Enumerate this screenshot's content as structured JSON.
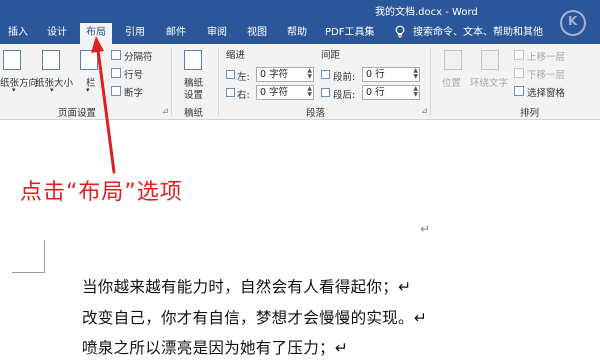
{
  "window": {
    "title": "我的文档.docx  -  Word"
  },
  "tabs": [
    "插入",
    "设计",
    "布局",
    "引用",
    "邮件",
    "审阅",
    "视图",
    "帮助",
    "PDF工具集"
  ],
  "active_tab": "布局",
  "search": {
    "text": "搜索命令、文本、帮助和其他"
  },
  "ribbon": {
    "page_setup": {
      "group_label": "页面设置",
      "orientation": "纸张方向",
      "size": "纸张大小",
      "columns": "栏",
      "breaks": "分隔符",
      "line_numbers": "行号",
      "hyphenation": "断字"
    },
    "draft": {
      "label_line1": "稿纸",
      "label_line2": "设置",
      "group_label": "稿纸"
    },
    "paragraph": {
      "group_label": "段落",
      "indent_header": "缩进",
      "spacing_header": "间距",
      "left_label": "左:",
      "right_label": "右:",
      "left_value": "0 字符",
      "right_value": "0 字符",
      "before_label": "段前:",
      "after_label": "段后:",
      "before_value": "0 行",
      "after_value": "0 行"
    },
    "arrange": {
      "group_label": "排列",
      "position": "位置",
      "wrap_text": "环绕文字",
      "bring_forward": "上移一层",
      "send_backward": "下移一层",
      "selection_pane": "选择窗格"
    }
  },
  "annotation": {
    "text": "点击“布局”选项",
    "color": "#e02020"
  },
  "document": {
    "lines": [
      "当你越来越有能力时，自然会有人看得起你；↵",
      "改变自己，你才有自信，梦想才会慢慢的实现。↵",
      "喷泉之所以漂亮是因为她有了压力；↵"
    ],
    "paragraph_mark": "↵"
  },
  "colors": {
    "accent": "#2b579a",
    "ribbon": "#f3f3f3",
    "annotation": "#e02020"
  }
}
